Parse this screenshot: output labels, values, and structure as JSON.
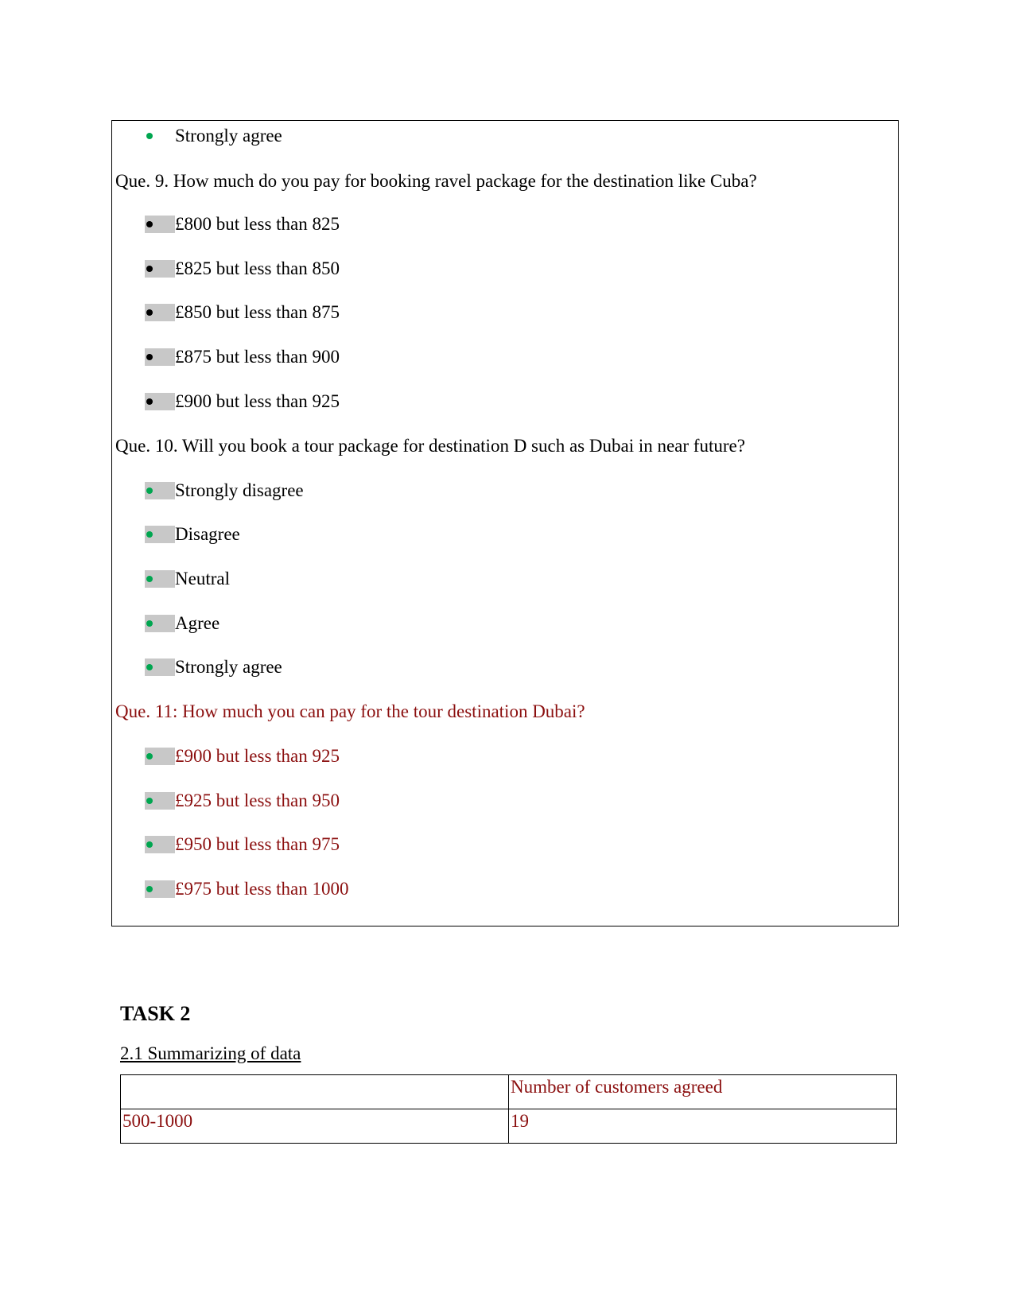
{
  "colors": {
    "bullet_green": "#00a650",
    "bullet_black": "#000000",
    "highlight_gray": "#c8c8c8",
    "accent_red": "#8b0f0f"
  },
  "top_item": {
    "label": "Strongly agree",
    "bullet": "green"
  },
  "q9": {
    "question": "Que. 9. How much do you pay for booking ravel package for the destination like Cuba?",
    "options": [
      "£800 but less than 825",
      "£825 but less than 850",
      "£850 but less than 875",
      "£875 but less than 900",
      "£900 but less than 925"
    ]
  },
  "q10": {
    "question": "Que. 10. Will you book a tour package for destination D such as Dubai in near future?",
    "options": [
      "Strongly disagree",
      "Disagree",
      "Neutral",
      "Agree",
      "Strongly agree"
    ]
  },
  "q11": {
    "question": "Que. 11: How much you can pay for the tour destination Dubai?",
    "options": [
      "£900 but less than 925",
      "£925 but less than 950",
      "£950 but less than 975",
      "£975 but less than 1000"
    ]
  },
  "task": {
    "title": "TASK 2",
    "subtitle": "2.1 Summarizing of data"
  },
  "table": {
    "header": [
      "",
      "Number of customers agreed"
    ],
    "rows": [
      [
        "500-1000",
        "19"
      ]
    ]
  }
}
